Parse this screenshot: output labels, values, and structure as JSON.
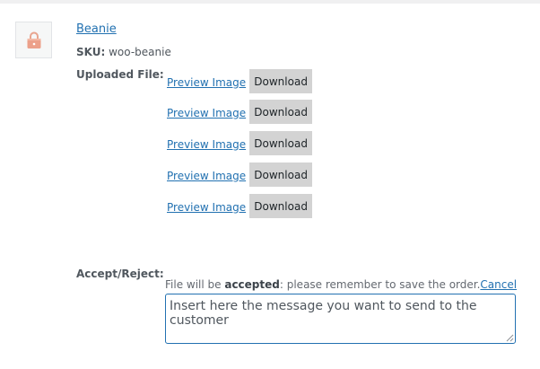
{
  "product": {
    "name": "Beanie",
    "sku_label": "SKU:",
    "sku_value": " woo-beanie",
    "thumbnail_icon": "lock-icon"
  },
  "uploaded_files": {
    "label": "Uploaded File:",
    "rows": [
      {
        "preview_label": "Preview Image",
        "download_label": "Download"
      },
      {
        "preview_label": "Preview Image",
        "download_label": "Download"
      },
      {
        "preview_label": "Preview Image",
        "download_label": "Download"
      },
      {
        "preview_label": "Preview Image",
        "download_label": "Download"
      },
      {
        "preview_label": "Preview Image",
        "download_label": "Download"
      }
    ]
  },
  "accept_reject": {
    "label": "Accept/Reject:",
    "notice_prefix": "File will be ",
    "notice_status": "accepted",
    "notice_suffix": ": please remember to save the order.",
    "cancel_label": "Cancel",
    "message_placeholder": "Insert here the message you want to send to the customer"
  },
  "colors": {
    "link": "#2271b1",
    "button_bg": "#d3d3d3",
    "label_text": "#50575e",
    "thumbnail_icon": "#e8a58f"
  }
}
